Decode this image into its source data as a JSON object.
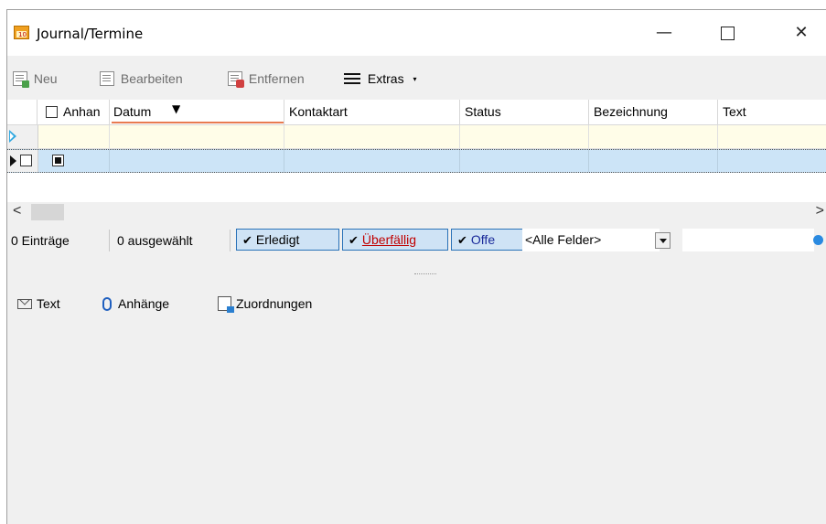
{
  "window": {
    "title": "Journal/Termine",
    "minimize_glyph": "—",
    "close_glyph": "✕"
  },
  "toolbar": {
    "new_label": "Neu",
    "edit_label": "Bearbeiten",
    "delete_label": "Entfernen",
    "extras_label": "Extras",
    "extras_arrow": "▾"
  },
  "grid": {
    "columns": [
      {
        "key": "anhang",
        "label": "Anhan"
      },
      {
        "key": "datum",
        "label": "Datum",
        "sort_glyph": "▼"
      },
      {
        "key": "kontaktart",
        "label": "Kontaktart"
      },
      {
        "key": "status",
        "label": "Status"
      },
      {
        "key": "bezeichnung",
        "label": "Bezeichnung"
      },
      {
        "key": "text",
        "label": "Text"
      }
    ],
    "filter_row_color": "#fffde8",
    "selected_row_color": "#cce4f7"
  },
  "scrollbar": {
    "left_glyph": "<",
    "right_glyph": ">"
  },
  "statusbar": {
    "entries": "0 Einträge",
    "selected": "0 ausgewählt",
    "filter_done": "Erledigt",
    "filter_overdue": "Überfällig",
    "filter_open": "Offe",
    "check_glyph": "✔",
    "field_select": "<Alle Felder>",
    "search_value": ""
  },
  "bottom_tabs": {
    "text": "Text",
    "attachments": "Anhänge",
    "assignments": "Zuordnungen"
  },
  "colors": {
    "accent_sort_underline": "#e87a50",
    "filter_button_bg": "#cfe3f5",
    "filter_button_border": "#2a72b8"
  }
}
